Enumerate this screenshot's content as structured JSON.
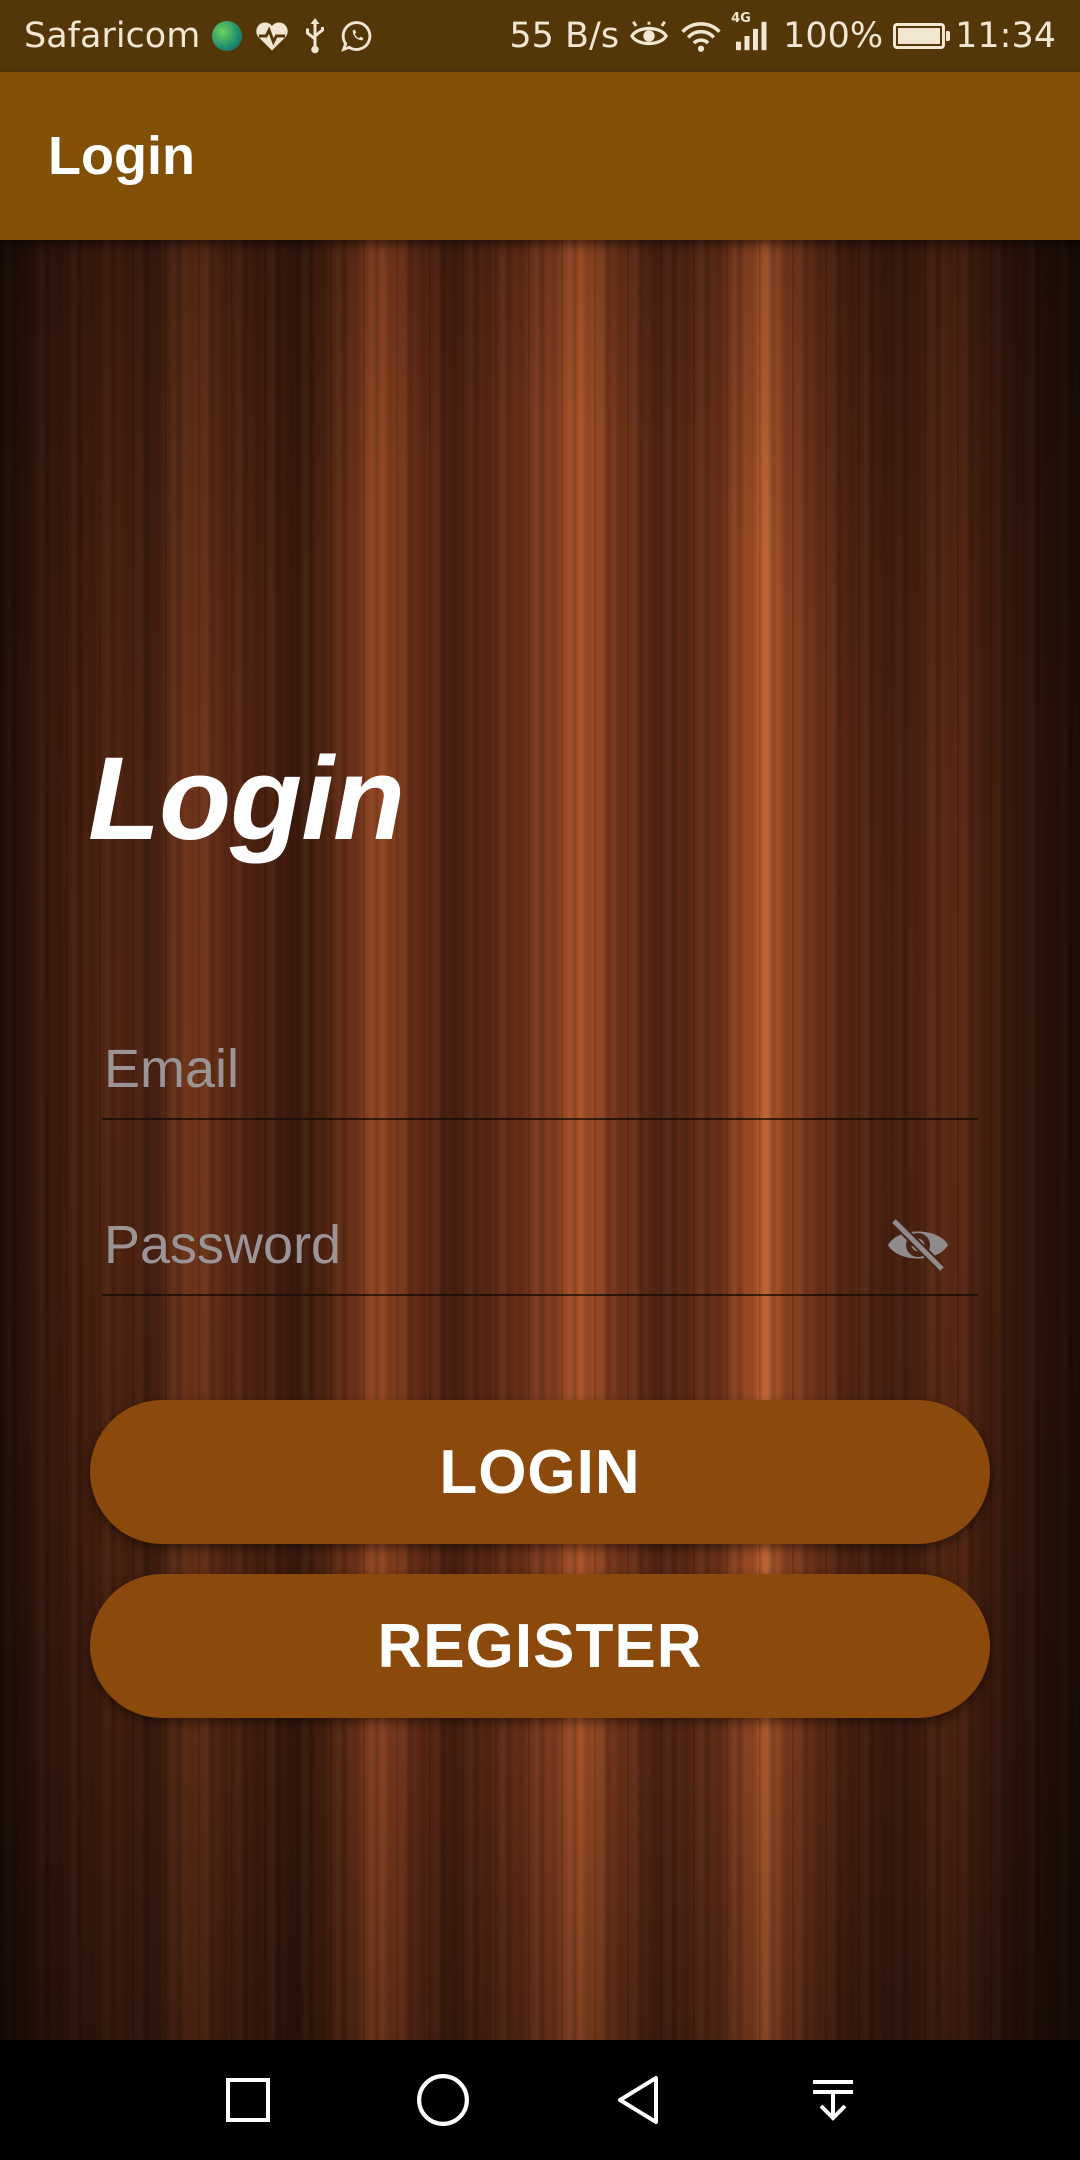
{
  "status_bar": {
    "carrier": "Safaricom",
    "net_speed": "55 B/s",
    "network_type": "4G",
    "battery": "100%",
    "battery_level": 1.0,
    "time": "11:34",
    "left_icons": [
      "globe-icon",
      "heart-pulse-icon",
      "usb-icon",
      "whatsapp-icon"
    ],
    "right_icons": [
      "eye-comfort-icon",
      "wifi-icon",
      "signal-icon",
      "battery-icon"
    ]
  },
  "app_bar": {
    "title": "Login"
  },
  "form": {
    "heading": "Login",
    "email": {
      "placeholder": "Email",
      "value": ""
    },
    "password": {
      "placeholder": "Password",
      "value": "",
      "toggle_icon": "eye-off-icon"
    },
    "login_label": "LOGIN",
    "register_label": "REGISTER"
  },
  "nav_bar": {
    "buttons": [
      "recents-square-icon",
      "home-circle-icon",
      "back-triangle-icon",
      "notification-pull-icon"
    ]
  },
  "colors": {
    "status_bar": "#533709",
    "app_bar": "#815006",
    "button": "#8b4a0b",
    "placeholder": "#9a9496"
  }
}
